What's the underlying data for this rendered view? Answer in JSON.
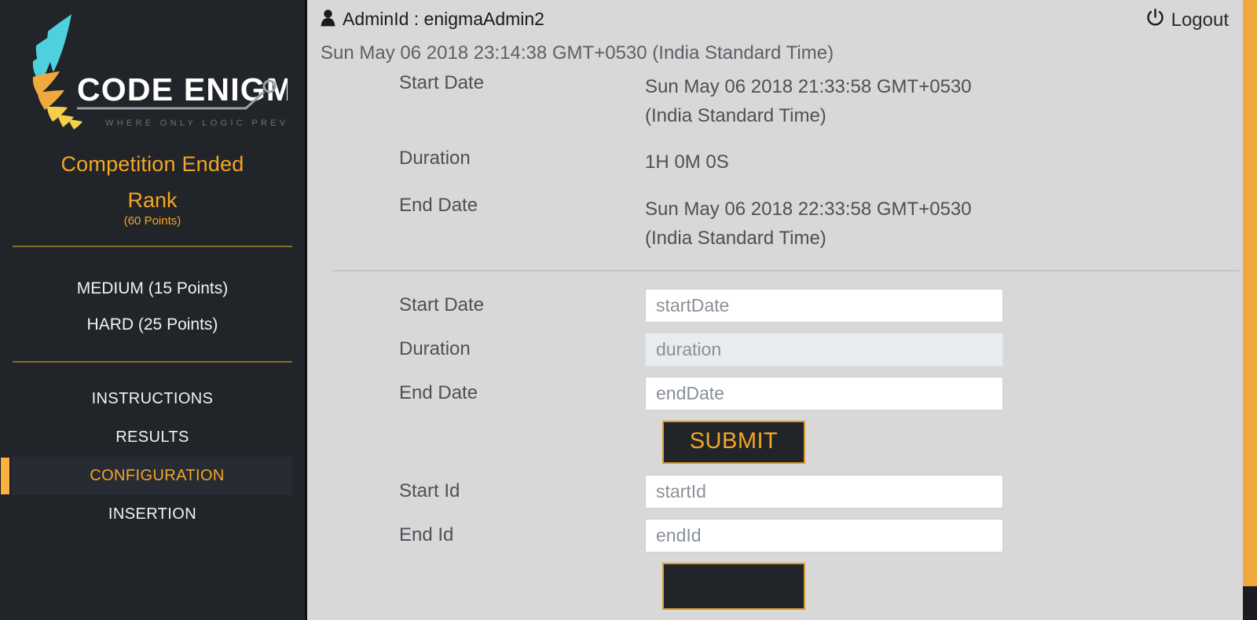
{
  "sidebar": {
    "logo": {
      "brand": "CODE ENIGMA",
      "tagline": "WHERE ONLY LOGIC PREVAILS",
      "wing_color_top": "#4fd0dd",
      "wing_color_bottom": "#f0a93c"
    },
    "status_title": "Competition Ended",
    "rank_title": "Rank",
    "rank_points": "(60 Points)",
    "difficulty_items": [
      {
        "label": "MEDIUM (15 Points)"
      },
      {
        "label": "HARD (25 Points)"
      }
    ],
    "nav_items": [
      {
        "label": "INSTRUCTIONS",
        "active": false
      },
      {
        "label": "RESULTS",
        "active": false
      },
      {
        "label": "CONFIGURATION",
        "active": true
      },
      {
        "label": "INSERTION",
        "active": false
      }
    ],
    "accent_color": "#f5a623",
    "background_color": "#212429"
  },
  "header": {
    "admin_label": "AdminId : enigmaAdmin2",
    "current_time": "Sun May 06 2018 23:14:38 GMT+0530 (India Standard Time)",
    "logout_label": "Logout"
  },
  "info": {
    "rows": [
      {
        "label": "Start Date",
        "value": "Sun May 06 2018 21:33:58 GMT+0530 (India Standard Time)"
      },
      {
        "label": "Duration",
        "value": "1H 0M 0S"
      },
      {
        "label": "End Date",
        "value": "Sun May 06 2018 22:33:58 GMT+0530 (India Standard Time)"
      }
    ]
  },
  "form": {
    "schedule_fields": [
      {
        "label": "Start Date",
        "placeholder": "startDate",
        "value": "",
        "disabled": false
      },
      {
        "label": "Duration",
        "placeholder": "duration",
        "value": "",
        "disabled": true
      },
      {
        "label": "End Date",
        "placeholder": "endDate",
        "value": "",
        "disabled": false
      }
    ],
    "schedule_submit_label": "SUBMIT",
    "id_fields": [
      {
        "label": "Start Id",
        "placeholder": "startId",
        "value": "",
        "disabled": false
      },
      {
        "label": "End Id",
        "placeholder": "endId",
        "value": "",
        "disabled": false
      }
    ],
    "id_submit_label": ""
  },
  "scrollbar": {
    "thumb_color": "#f0a83c",
    "track_color": "#1b1d23"
  }
}
